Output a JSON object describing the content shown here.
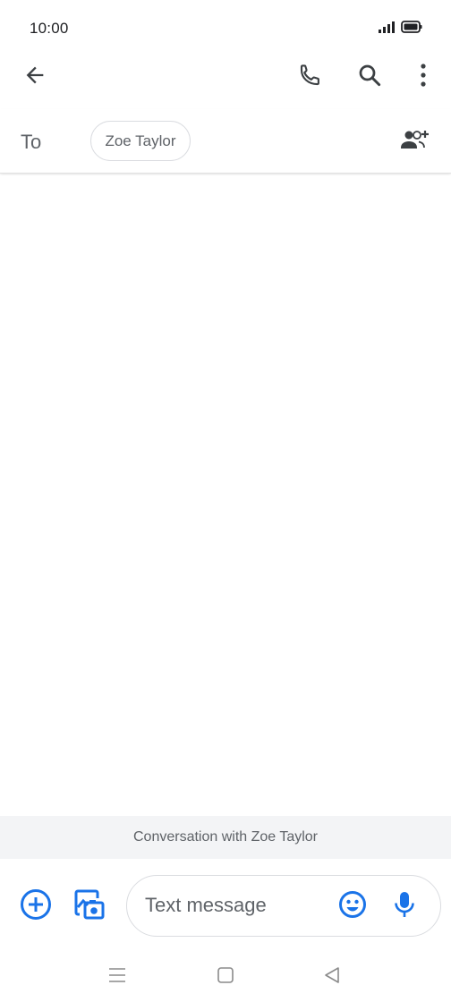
{
  "status_bar": {
    "time": "10:00",
    "icons": [
      "signal-icon",
      "battery-icon"
    ]
  },
  "app_bar": {
    "back_icon": "arrow-back-icon",
    "actions": [
      "phone-icon",
      "search-icon",
      "more-vert-icon"
    ]
  },
  "recipients": {
    "to_label": "To",
    "chips": [
      "Zoe Taylor"
    ],
    "add_icon": "add-person-icon"
  },
  "conversation": {
    "banner": "Conversation with Zoe Taylor"
  },
  "compose": {
    "placeholder": "Text message",
    "icons": [
      "add-circle-icon",
      "gallery-camera-icon",
      "emoji-icon",
      "mic-icon"
    ]
  },
  "nav": {
    "icons": [
      "menu-lines-icon",
      "home-square-icon",
      "back-triangle-icon"
    ]
  },
  "colors": {
    "accent": "#1a73e8",
    "icon_gray": "#5f6368",
    "banner_bg": "#f3f4f6"
  }
}
